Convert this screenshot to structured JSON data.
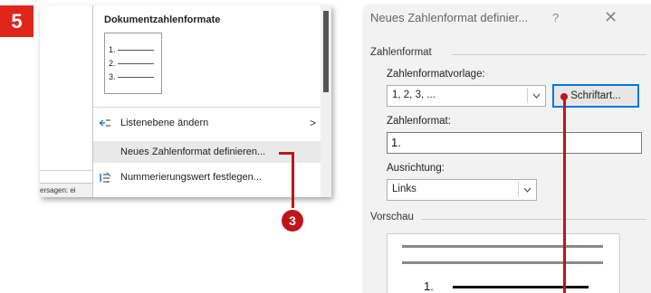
{
  "step_number": "5",
  "menu": {
    "partial_status_text": "ersagen: ei",
    "title": "Dokumentzahlenformate",
    "preview_items": [
      "1.",
      "2.",
      "3."
    ],
    "items": [
      {
        "label": "Listenebene ändern",
        "icon": "list-level-icon",
        "has_submenu": true
      },
      {
        "label": "Neues Zahlenformat definieren...",
        "highlighted": true
      },
      {
        "label": "Nummerierungswert festlegen...",
        "icon": "numbering-value-icon"
      }
    ],
    "submenu_arrow": ">"
  },
  "callout_number": "3",
  "dialog": {
    "title": "Neues Zahlenformat definier...",
    "help": "?",
    "close": "✕",
    "section_format": "Zahlenformat",
    "template_label": "Zahlenformatvorlage:",
    "template_value": "1, 2, 3, ...",
    "font_button": "Schriftart...",
    "format_label": "Zahlenformat:",
    "format_value": "1.",
    "alignment_label": "Ausrichtung:",
    "alignment_value": "Links",
    "section_preview": "Vorschau",
    "preview_number": "1."
  },
  "colors": {
    "accent_red": "#c0151b",
    "badge_red": "#e1251b",
    "focus_blue": "#0078d7"
  }
}
